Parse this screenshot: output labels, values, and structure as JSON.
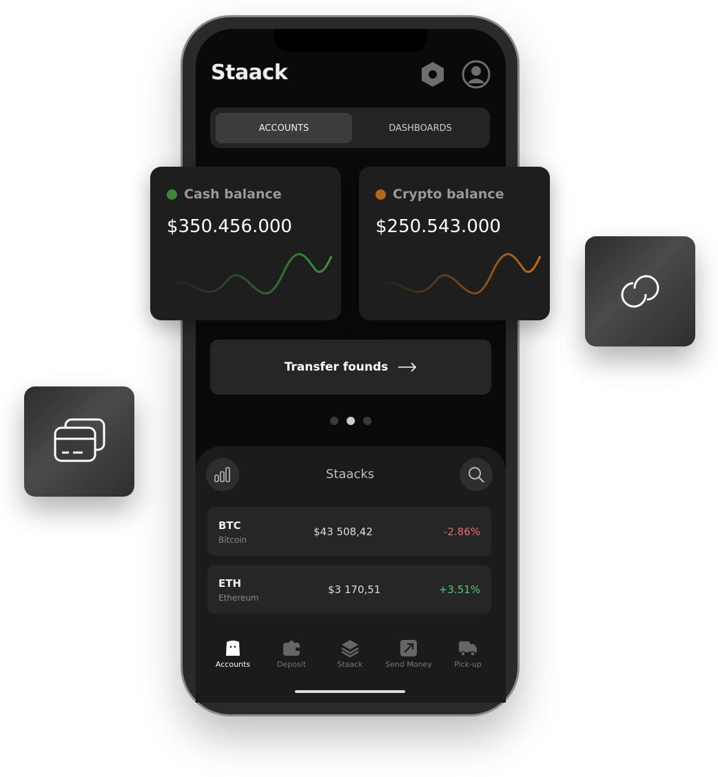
{
  "app": {
    "title": "Staack"
  },
  "header": {
    "settings_icon": "hexagon-nut-icon",
    "profile_icon": "user-circle-icon"
  },
  "tabs": [
    {
      "label": "ACCOUNTS",
      "active": true
    },
    {
      "label": "DASHBOARDS",
      "active": false
    }
  ],
  "cards": [
    {
      "label": "Cash balance",
      "value": "$350.456.000",
      "color": "#3a8a3a"
    },
    {
      "label": "Crypto balance",
      "value": "$250.543.000",
      "color": "#b8641a"
    }
  ],
  "transfer": {
    "label": "Transfer founds"
  },
  "pager": {
    "count": 3,
    "active": 1
  },
  "staacks": {
    "title": "Staacks",
    "rows": [
      {
        "symbol": "BTC",
        "name": "Bitcoin",
        "price": "$43 508,42",
        "change": "-2.86%",
        "change_color": "#f06a6a"
      },
      {
        "symbol": "ETH",
        "name": "Ethereum",
        "price": "$3 170,51",
        "change": "+3.51%",
        "change_color": "#4cd07d"
      }
    ]
  },
  "nav": [
    {
      "label": "Accounts",
      "active": true
    },
    {
      "label": "Deposit"
    },
    {
      "label": "Staack"
    },
    {
      "label": "Send Money"
    },
    {
      "label": "Pick-up"
    }
  ]
}
